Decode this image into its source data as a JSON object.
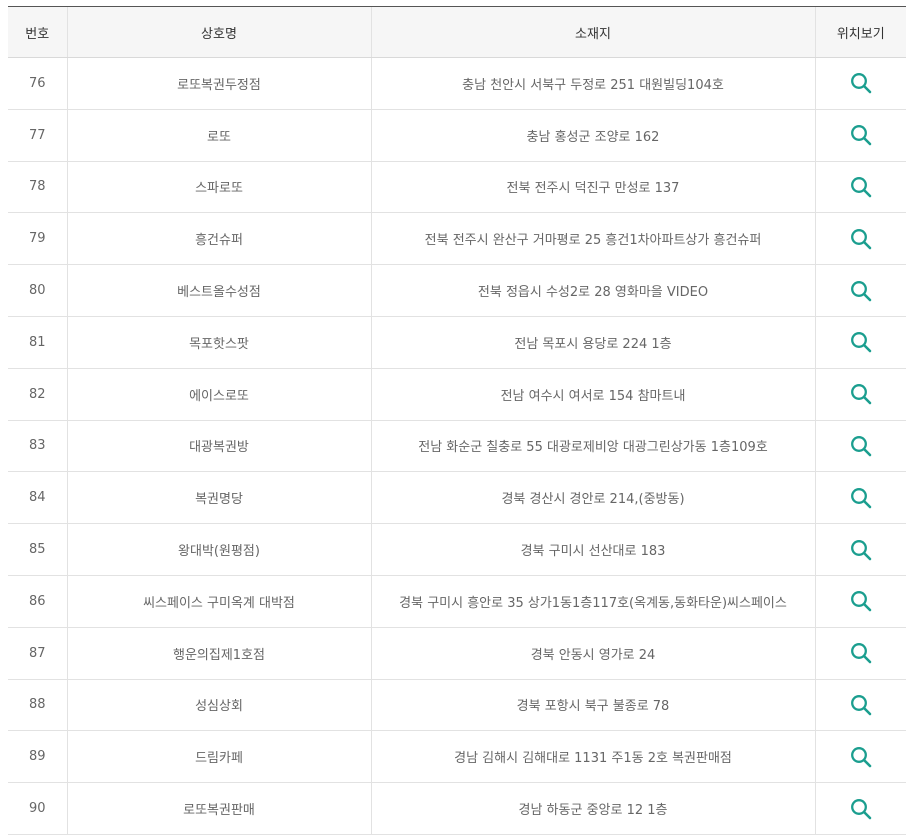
{
  "table": {
    "headers": {
      "number": "번호",
      "store_name": "상호명",
      "location": "소재지",
      "view_location": "위치보기"
    },
    "icon": "search-icon",
    "accent_color": "#1b9e8f",
    "rows": [
      {
        "number": "76",
        "store_name": "로또복권두정점",
        "location": "충남 천안시 서북구 두정로 251 대원빌딩104호"
      },
      {
        "number": "77",
        "store_name": "로또",
        "location": "충남 홍성군 조양로 162"
      },
      {
        "number": "78",
        "store_name": "스파로또",
        "location": "전북 전주시 덕진구 만성로 137"
      },
      {
        "number": "79",
        "store_name": "흥건슈퍼",
        "location": "전북 전주시 완산구 거마평로 25 흥건1차아파트상가 흥건슈퍼"
      },
      {
        "number": "80",
        "store_name": "베스트올수성점",
        "location": "전북 정읍시 수성2로 28 영화마을 VIDEO"
      },
      {
        "number": "81",
        "store_name": "목포핫스팟",
        "location": "전남 목포시 용당로 224 1층"
      },
      {
        "number": "82",
        "store_name": "에이스로또",
        "location": "전남 여수시 여서로 154 참마트내"
      },
      {
        "number": "83",
        "store_name": "대광복권방",
        "location": "전남 화순군 칠충로 55 대광로제비앙 대광그린상가동 1층109호"
      },
      {
        "number": "84",
        "store_name": "복권명당",
        "location": "경북 경산시 경안로 214,(중방동)"
      },
      {
        "number": "85",
        "store_name": "왕대박(원평점)",
        "location": "경북 구미시 선산대로 183"
      },
      {
        "number": "86",
        "store_name": "씨스페이스 구미옥계 대박점",
        "location": "경북 구미시 흥안로 35 상가1동1층117호(옥계동,동화타운)씨스페이스"
      },
      {
        "number": "87",
        "store_name": "행운의집제1호점",
        "location": "경북 안동시 영가로 24"
      },
      {
        "number": "88",
        "store_name": "성심상회",
        "location": "경북 포항시 북구 불종로 78"
      },
      {
        "number": "89",
        "store_name": "드림카페",
        "location": "경남 김해시 김해대로 1131 주1동 2호 복권판매점"
      },
      {
        "number": "90",
        "store_name": "로또복권판매",
        "location": "경남 하동군 중앙로 12 1층"
      }
    ]
  }
}
